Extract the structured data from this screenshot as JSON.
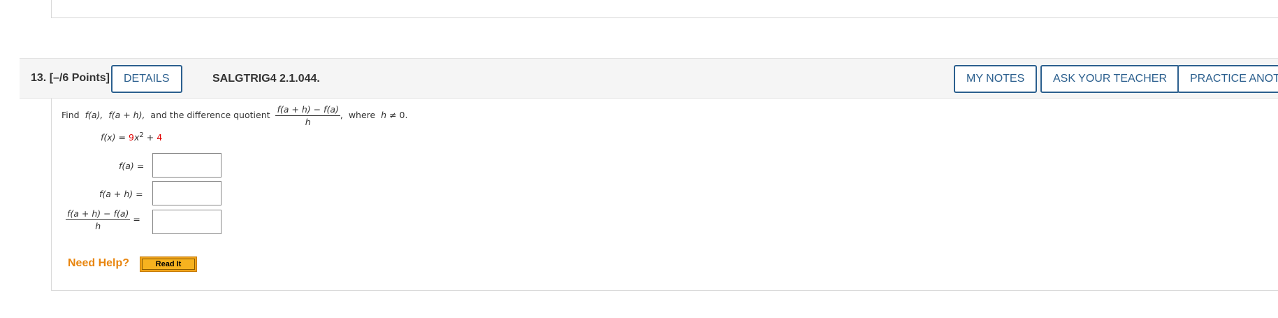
{
  "question": {
    "number": "13.",
    "points": "[–/6 Points]",
    "details_label": "DETAILS",
    "code": "SALGTRIG4 2.1.044.",
    "my_notes_label": "MY NOTES",
    "ask_teacher_label": "ASK YOUR TEACHER",
    "practice_label": "PRACTICE ANOTHER"
  },
  "prompt": {
    "find": "Find",
    "fa": "f(a),",
    "fah": "f(a + h),",
    "and_text": "and the difference quotient",
    "dq_num": "f(a + h) − f(a)",
    "dq_den": "h",
    "comma": ",",
    "where": "where",
    "cond_var": "h",
    "cond_rest": "≠ 0."
  },
  "function": {
    "lhs": "f(x)",
    "eq": "=",
    "coef": "9",
    "var": "x",
    "exp": "2",
    "plus": "+",
    "const": "4"
  },
  "answers": {
    "fa_label": "f(a)",
    "fah_label": "f(a + h)",
    "dq_num": "f(a + h) − f(a)",
    "dq_den": "h",
    "eq": "=",
    "fa_value": "",
    "fah_value": "",
    "dq_value": ""
  },
  "help": {
    "need_help": "Need Help?",
    "read_it": "Read It"
  },
  "colors": {
    "accent": "#2b5f8e",
    "help_orange": "#e8850e",
    "highlight_red": "#e00000"
  }
}
